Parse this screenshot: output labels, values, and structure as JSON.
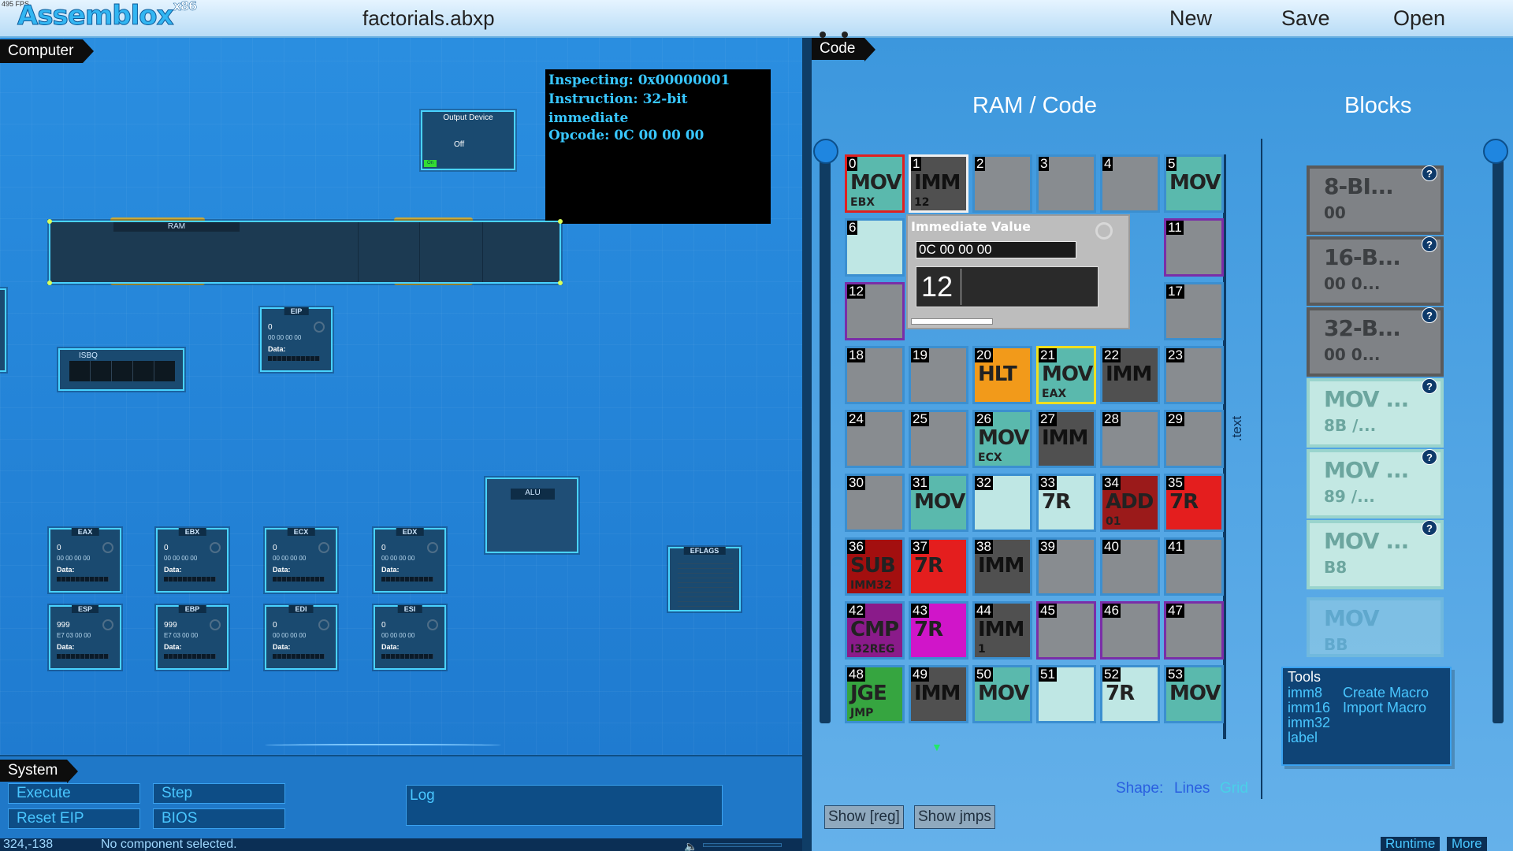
{
  "app": {
    "fps": "495 FPS",
    "logo": "Assemblox",
    "logo_sup": "x86",
    "filename": "factorials.abxp"
  },
  "menu": {
    "new": "New",
    "save": "Save",
    "open": "Open"
  },
  "computer": {
    "tab": "Computer",
    "inspect": {
      "line1": "Inspecting: 0x00000001",
      "line2": "Instruction: 32-bit immediate",
      "line3": "Opcode: 0C 00 00 00"
    },
    "output_device": {
      "title": "Output Device",
      "state": "Off",
      "indicator": "On"
    },
    "ram_label": "RAM",
    "isbq_label": "ISBQ",
    "eip": {
      "title": "EIP",
      "value": "0",
      "hex": "00 00 00 00",
      "data_label": "Data:"
    },
    "alu_label": "ALU",
    "eflags_label": "EFLAGS",
    "registers": [
      {
        "name": "EAX",
        "value": "0",
        "hex": "00 00 00 00",
        "data_label": "Data:"
      },
      {
        "name": "EBX",
        "value": "0",
        "hex": "00 00 00 00",
        "data_label": "Data:"
      },
      {
        "name": "ECX",
        "value": "0",
        "hex": "00 00 00 00",
        "data_label": "Data:"
      },
      {
        "name": "EDX",
        "value": "0",
        "hex": "00 00 00 00",
        "data_label": "Data:"
      },
      {
        "name": "ESP",
        "value": "999",
        "hex": "E7 03 00 00",
        "data_label": "Data:"
      },
      {
        "name": "EBP",
        "value": "999",
        "hex": "E7 03 00 00",
        "data_label": "Data:"
      },
      {
        "name": "EDI",
        "value": "0",
        "hex": "00 00 00 00",
        "data_label": "Data:"
      },
      {
        "name": "ESI",
        "value": "0",
        "hex": "00 00 00 00",
        "data_label": "Data:"
      }
    ]
  },
  "system": {
    "tab": "System",
    "execute": "Execute",
    "step": "Step",
    "reset_eip": "Reset EIP",
    "bios": "BIOS",
    "log_label": "Log"
  },
  "status": {
    "coords": "324,-138",
    "message": "No component selected."
  },
  "code": {
    "tab": "Code",
    "ram_heading": "RAM / Code",
    "blocks_heading": "Blocks",
    "text_label": ".text",
    "popup": {
      "title": "Immediate Value",
      "hex": "0C 00 00 00",
      "decimal": "12"
    },
    "cells": [
      {
        "n": "0",
        "m": "MOV",
        "s": "EBX",
        "c": "c-mov"
      },
      {
        "n": "1",
        "m": "IMM",
        "s": "12",
        "c": "c-imm"
      },
      {
        "n": "2",
        "m": "",
        "s": "",
        "c": ""
      },
      {
        "n": "3",
        "m": "",
        "s": "",
        "c": ""
      },
      {
        "n": "4",
        "m": "",
        "s": "",
        "c": ""
      },
      {
        "n": "5",
        "m": "MOV",
        "s": "",
        "c": "c-mov"
      },
      {
        "n": "6",
        "m": "",
        "s": "",
        "c": "c-light"
      },
      {
        "n": "11",
        "m": "",
        "s": "",
        "c": "",
        "o": 1
      },
      {
        "n": "12",
        "m": "",
        "s": "",
        "c": "",
        "o": 1
      },
      {
        "n": "17",
        "m": "",
        "s": "",
        "c": ""
      },
      {
        "n": "18",
        "m": "",
        "s": "",
        "c": ""
      },
      {
        "n": "19",
        "m": "",
        "s": "",
        "c": ""
      },
      {
        "n": "20",
        "m": "HLT",
        "s": "",
        "c": "c-hlt"
      },
      {
        "n": "21",
        "m": "MOV",
        "s": "EAX",
        "c": "c-mov"
      },
      {
        "n": "22",
        "m": "IMM",
        "s": "",
        "c": "c-imm"
      },
      {
        "n": "23",
        "m": "",
        "s": "",
        "c": ""
      },
      {
        "n": "24",
        "m": "",
        "s": "",
        "c": ""
      },
      {
        "n": "25",
        "m": "",
        "s": "",
        "c": ""
      },
      {
        "n": "26",
        "m": "MOV",
        "s": "ECX",
        "c": "c-mov"
      },
      {
        "n": "27",
        "m": "IMM",
        "s": "",
        "c": "c-imm"
      },
      {
        "n": "28",
        "m": "",
        "s": "",
        "c": ""
      },
      {
        "n": "29",
        "m": "",
        "s": "",
        "c": ""
      },
      {
        "n": "30",
        "m": "",
        "s": "",
        "c": ""
      },
      {
        "n": "31",
        "m": "MOV",
        "s": "",
        "c": "c-mov"
      },
      {
        "n": "32",
        "m": "",
        "s": "",
        "c": "c-light"
      },
      {
        "n": "33",
        "m": "7R",
        "s": "",
        "c": "c-light"
      },
      {
        "n": "34",
        "m": "ADD",
        "s": "01",
        "c": "c-add"
      },
      {
        "n": "35",
        "m": "7R",
        "s": "",
        "c": "c-jr"
      },
      {
        "n": "36",
        "m": "SUB",
        "s": "IMM32",
        "c": "c-sub"
      },
      {
        "n": "37",
        "m": "7R",
        "s": "",
        "c": "c-jr"
      },
      {
        "n": "38",
        "m": "IMM",
        "s": "",
        "c": "c-imm"
      },
      {
        "n": "39",
        "m": "",
        "s": "",
        "c": ""
      },
      {
        "n": "40",
        "m": "",
        "s": "",
        "c": ""
      },
      {
        "n": "41",
        "m": "",
        "s": "",
        "c": ""
      },
      {
        "n": "42",
        "m": "CMP",
        "s": "I32REG",
        "c": "c-cmp"
      },
      {
        "n": "43",
        "m": "7R",
        "s": "",
        "c": "c-jrp"
      },
      {
        "n": "44",
        "m": "IMM",
        "s": "1",
        "c": "c-imm"
      },
      {
        "n": "45",
        "m": "",
        "s": "",
        "c": "",
        "o": 1
      },
      {
        "n": "46",
        "m": "",
        "s": "",
        "c": "",
        "o": 1
      },
      {
        "n": "47",
        "m": "",
        "s": "",
        "c": "",
        "o": 1
      },
      {
        "n": "48",
        "m": "JGE",
        "s": "JMP",
        "c": "c-jge"
      },
      {
        "n": "49",
        "m": "IMM",
        "s": "",
        "c": "c-imm"
      },
      {
        "n": "50",
        "m": "MOV",
        "s": "",
        "c": "c-mov"
      },
      {
        "n": "51",
        "m": "",
        "s": "",
        "c": "c-light"
      },
      {
        "n": "52",
        "m": "7R",
        "s": "",
        "c": "c-light"
      },
      {
        "n": "53",
        "m": "MOV",
        "s": "",
        "c": "c-mov"
      }
    ],
    "blocks": [
      {
        "t": "8-BI...",
        "s": "00",
        "g": false
      },
      {
        "t": "16-B...",
        "s": "00 0...",
        "g": false
      },
      {
        "t": "32-B...",
        "s": "00 0...",
        "g": false
      },
      {
        "t": "MOV ...",
        "s": "8B /...",
        "g": true
      },
      {
        "t": "MOV ...",
        "s": "89 /...",
        "g": true
      },
      {
        "t": "MOV ...",
        "s": "B8",
        "g": true
      }
    ],
    "ghost_block": {
      "t": "MOV",
      "s": "BB"
    },
    "tools": {
      "title": "Tools",
      "imm8": "imm8",
      "imm16": "imm16",
      "imm32": "imm32",
      "label": "label",
      "create_macro": "Create Macro",
      "import_macro": "Import Macro"
    },
    "shape": {
      "label": "Shape:",
      "lines": "Lines",
      "grid": "Grid"
    },
    "show_reg": "Show [reg]",
    "show_jmps": "Show jmps",
    "runtime": "Runtime",
    "more": "More"
  }
}
